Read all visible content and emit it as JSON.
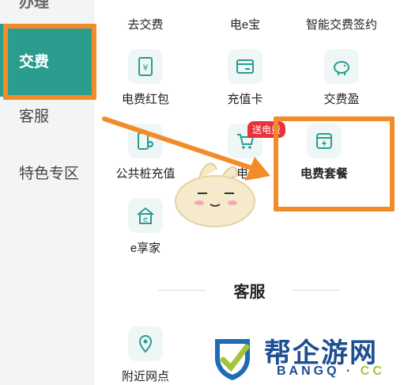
{
  "sidebar": {
    "items": [
      {
        "label": "办理"
      },
      {
        "label": "交费"
      },
      {
        "label": "客服"
      },
      {
        "label": "特色专区"
      }
    ]
  },
  "grid": {
    "items": [
      {
        "label": "去交费",
        "icon": "pay-icon"
      },
      {
        "label": "电e宝",
        "icon": "wallet-icon"
      },
      {
        "label": "智能交费签约",
        "icon": "sign-icon"
      },
      {
        "label": "电费红包",
        "icon": "red-packet-icon"
      },
      {
        "label": "充值卡",
        "icon": "card-icon"
      },
      {
        "label": "交费盈",
        "icon": "piggy-bank-icon"
      },
      {
        "label": "公共桩充值",
        "icon": "charging-pile-icon"
      },
      {
        "label": "e电惠",
        "icon": "cart-icon"
      },
      {
        "label": "电费套餐",
        "icon": "package-bolt-icon"
      },
      {
        "label": "e享家",
        "icon": "home-e-icon"
      }
    ],
    "badge": "送电费"
  },
  "section": {
    "title": "客服",
    "items": [
      {
        "label": "附近网点",
        "icon": "map-pin-icon"
      }
    ]
  },
  "watermark": {
    "title": "帮企游网",
    "domain": "BANGQ",
    "dot": "·",
    "tld": "CC"
  },
  "colors": {
    "accent": "#2a9d8f",
    "highlight": "#f28c28",
    "badge": "#e8323c",
    "watermark": "#1e4f91"
  }
}
